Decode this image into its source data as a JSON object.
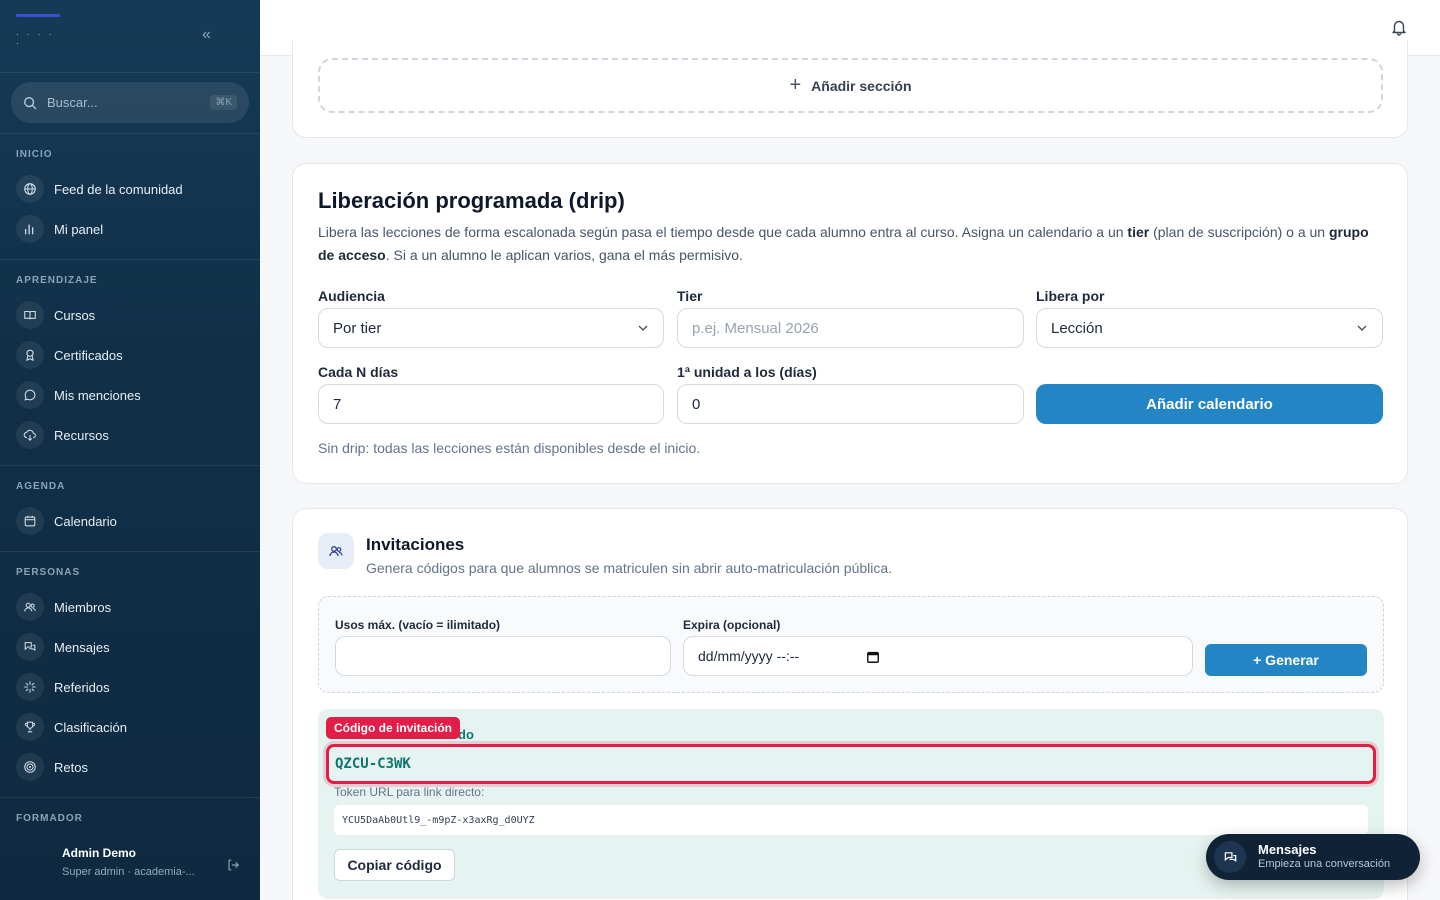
{
  "sidebar": {
    "search_placeholder": "Buscar...",
    "search_shortcut": "⌘K",
    "sections": {
      "inicio": "INICIO",
      "aprendizaje": "APRENDIZAJE",
      "agenda": "AGENDA",
      "personas": "PERSONAS",
      "formador": "FORMADOR"
    },
    "items": {
      "feed": "Feed de la comunidad",
      "panel": "Mi panel",
      "cursos": "Cursos",
      "certificados": "Certificados",
      "menciones": "Mis menciones",
      "recursos": "Recursos",
      "calendario": "Calendario",
      "miembros": "Miembros",
      "mensajes": "Mensajes",
      "referidos": "Referidos",
      "clasificacion": "Clasificación",
      "retos": "Retos"
    },
    "user": {
      "name": "Admin Demo",
      "role": "Super admin · academia-..."
    }
  },
  "add_section_label": "Añadir sección",
  "drip": {
    "title": "Liberación programada (drip)",
    "desc_1": "Libera las lecciones de forma escalonada según pasa el tiempo desde que cada alumno entra al curso. Asigna un calendario a un ",
    "desc_tier": "tier",
    "desc_2": " (plan de suscripción) o a un ",
    "desc_group": "grupo de acceso",
    "desc_3": ". Si a un alumno le aplican varios, gana el más permisivo.",
    "audiencia_label": "Audiencia",
    "audiencia_value": "Por tier",
    "tier_label": "Tier",
    "tier_placeholder": "p.ej. Mensual 2026",
    "libera_label": "Libera por",
    "libera_value": "Lección",
    "cada_label": "Cada N días",
    "cada_value": "7",
    "primera_label": "1ª unidad a los (días)",
    "primera_value": "0",
    "add_button": "Añadir calendario",
    "note": "Sin drip: todas las lecciones están disponibles desde el inicio."
  },
  "invites": {
    "title": "Invitaciones",
    "desc": "Genera códigos para que alumnos se matriculen sin abrir auto-matriculación pública.",
    "usos_label": "Usos máx. (vacío = ilimitado)",
    "expira_label": "Expira (opcional)",
    "expira_value": "dd/mm/yyyy --:--",
    "generate_button": "+ Generar",
    "generated_title_tail": "do",
    "code_tag": "Código de invitación",
    "code": "QZCU-C3WK",
    "token_label": "Token URL para link directo:",
    "token": "YCU5DaAb0Utl9_-m9pZ-x3axRg_d0UYZ",
    "copy_button": "Copiar código"
  },
  "messages_widget": {
    "title": "Mensajes",
    "subtitle": "Empieza una conversación"
  }
}
